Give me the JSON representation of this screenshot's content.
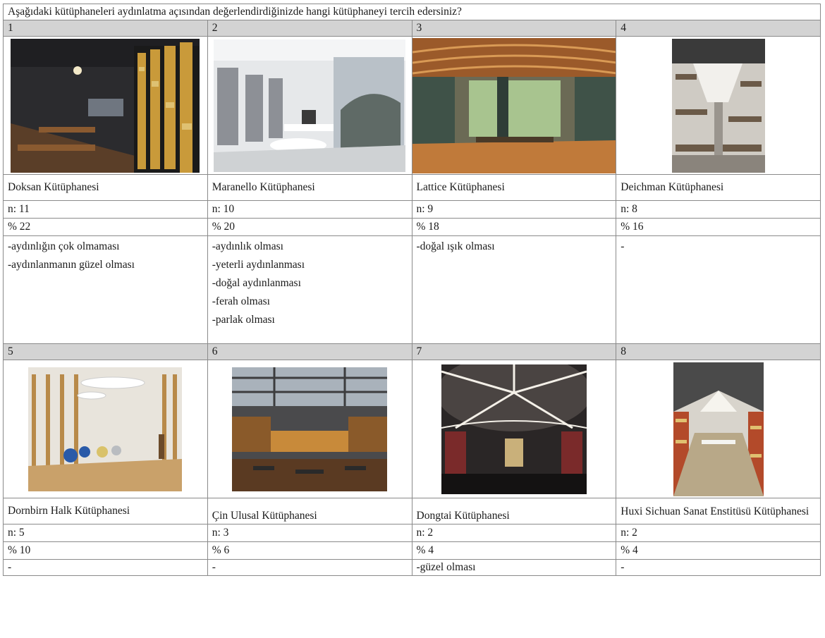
{
  "question": "Aşağıdaki kütüphaneleri aydınlatma açısından değerlendirdiğinizde hangi kütüphaneyi tercih edersiniz?",
  "libraries": [
    {
      "number": "1",
      "name": "Doksan Kütüphanesi",
      "n": "n: 11",
      "percent": "% 22",
      "comments": [
        "-aydınlığın çok olmaması",
        "-aydınlanmanın güzel olması"
      ]
    },
    {
      "number": "2",
      "name": "Maranello Kütüphanesi",
      "n": "n: 10",
      "percent": "% 20",
      "comments": [
        "-aydınlık olması",
        "-yeterli aydınlanması",
        "-doğal aydınlanması",
        "-ferah olması",
        "-parlak olması"
      ]
    },
    {
      "number": "3",
      "name": "Lattice Kütüphanesi",
      "n": "n: 9",
      "percent": "% 18",
      "comments": [
        "-doğal ışık olması"
      ]
    },
    {
      "number": "4",
      "name": "Deichman Kütüphanesi",
      "n": "n: 8",
      "percent": "% 16",
      "comments": [
        "-"
      ]
    },
    {
      "number": "5",
      "name": "Dornbirn Halk Kütüphanesi",
      "n": "n: 5",
      "percent": "% 10",
      "comments": [
        "-"
      ]
    },
    {
      "number": "6",
      "name": "Çin Ulusal Kütüphanesi",
      "n": "n: 3",
      "percent": "% 6",
      "comments": [
        "-"
      ]
    },
    {
      "number": "7",
      "name": "Dongtai Kütüphanesi",
      "n": "n: 2",
      "percent": "% 4",
      "comments": [
        "-güzel olması"
      ]
    },
    {
      "number": "8",
      "name": "Huxi Sichuan Sanat Enstitüsü Kütüphanesi",
      "n": "n: 2",
      "percent": "% 4",
      "comments": [
        "-"
      ]
    }
  ]
}
